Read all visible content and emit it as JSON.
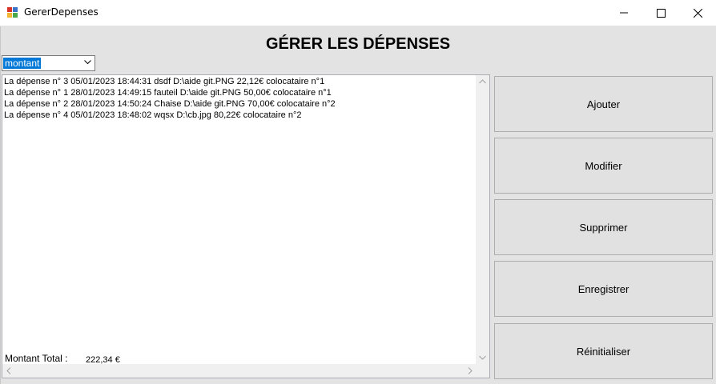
{
  "window": {
    "title": "GererDepenses",
    "minimize_icon": "minimize-icon",
    "maximize_icon": "maximize-icon",
    "close_icon": "close-icon"
  },
  "heading": "GÉRER LES DÉPENSES",
  "sort_combo": {
    "selected": "montant"
  },
  "expenses": [
    "La dépense n° 3 05/01/2023 18:44:31 dsdf D:\\aide git.PNG 22,12€ colocataire n°1",
    "La dépense n° 1 28/01/2023 14:49:15 fauteil D:\\aide git.PNG 50,00€ colocataire n°1",
    "La dépense n° 2 28/01/2023 14:50:24 Chaise D:\\aide git.PNG 70,00€ colocataire n°2",
    "La dépense n° 4 05/01/2023 18:48:02 wqsx D:\\cb.jpg 80,22€ colocataire n°2"
  ],
  "total": {
    "label": "Montant Total :",
    "value": "222,34 €"
  },
  "actions": {
    "add": "Ajouter",
    "edit": "Modifier",
    "delete": "Supprimer",
    "save": "Enregistrer",
    "reset": "Réinitialiser"
  },
  "colors": {
    "selection": "#0078d7",
    "button_bg": "#e1e1e1",
    "client_bg": "#e3e3e3"
  }
}
